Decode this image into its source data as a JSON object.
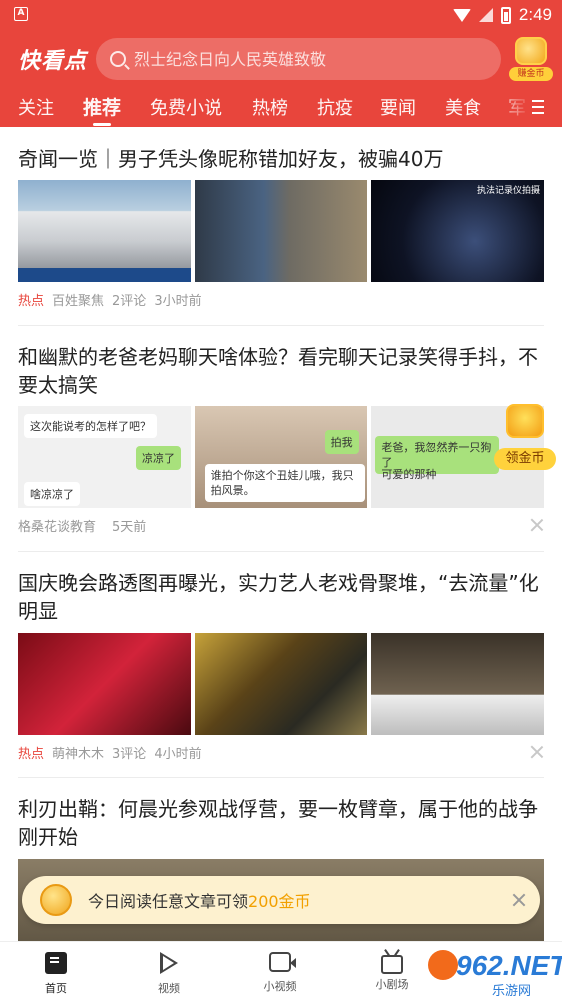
{
  "status_bar": {
    "time": "2:49",
    "app_icon_letter": "A"
  },
  "header": {
    "brand": "快看点",
    "search_placeholder": "烈士纪念日向人民英雄致敬",
    "coin_label": "赚金币",
    "tabs": [
      "关注",
      "推荐",
      "免费小说",
      "热榜",
      "抗疫",
      "要闻",
      "美食",
      "军"
    ],
    "active_tab": "推荐"
  },
  "articles": [
    {
      "title": "奇闻一览｜男子凭头像昵称错加好友，被骗40万",
      "tag": "热点",
      "source": "百姓聚焦",
      "comments": "2评论",
      "time": "3小时前",
      "thumb_texts": [
        "",
        "",
        "执法记录仪拍摄"
      ]
    },
    {
      "title": "和幽默的老爸老妈聊天啥体验？看完聊天记录笑得手抖，不要太搞笑",
      "tag": "",
      "source": "格桑花谈教育",
      "comments": "",
      "time": "5天前",
      "chat_bubbles": [
        "这次能说考的怎样了吧？",
        "凉凉了",
        "啥凉凉了",
        "拍我",
        "谁拍个你这个丑娃儿哦，我只拍风景。",
        "老爸，我忽然养一只狗了",
        "可爱的那种"
      ]
    },
    {
      "title": "国庆晚会路透图再曝光，实力艺人老戏骨聚堆，“去流量”化明显",
      "tag": "热点",
      "source": "萌神木木",
      "comments": "3评论",
      "time": "4小时前"
    },
    {
      "title": "利刃出鞘：何晨光参观战俘营，要一枚臂章，属于他的战争刚开始"
    }
  ],
  "floating_reward": {
    "label": "领金币"
  },
  "toast": {
    "text_prefix": "今日阅读任意文章可领",
    "amount": "200金币"
  },
  "bottom_nav": [
    {
      "label": "首页",
      "icon": "home-icon"
    },
    {
      "label": "视频",
      "icon": "play-icon"
    },
    {
      "label": "小视频",
      "icon": "small-video-icon"
    },
    {
      "label": "小剧场",
      "icon": "tv-icon"
    }
  ],
  "watermark": {
    "text": "962.NET",
    "sub": "乐游网"
  }
}
